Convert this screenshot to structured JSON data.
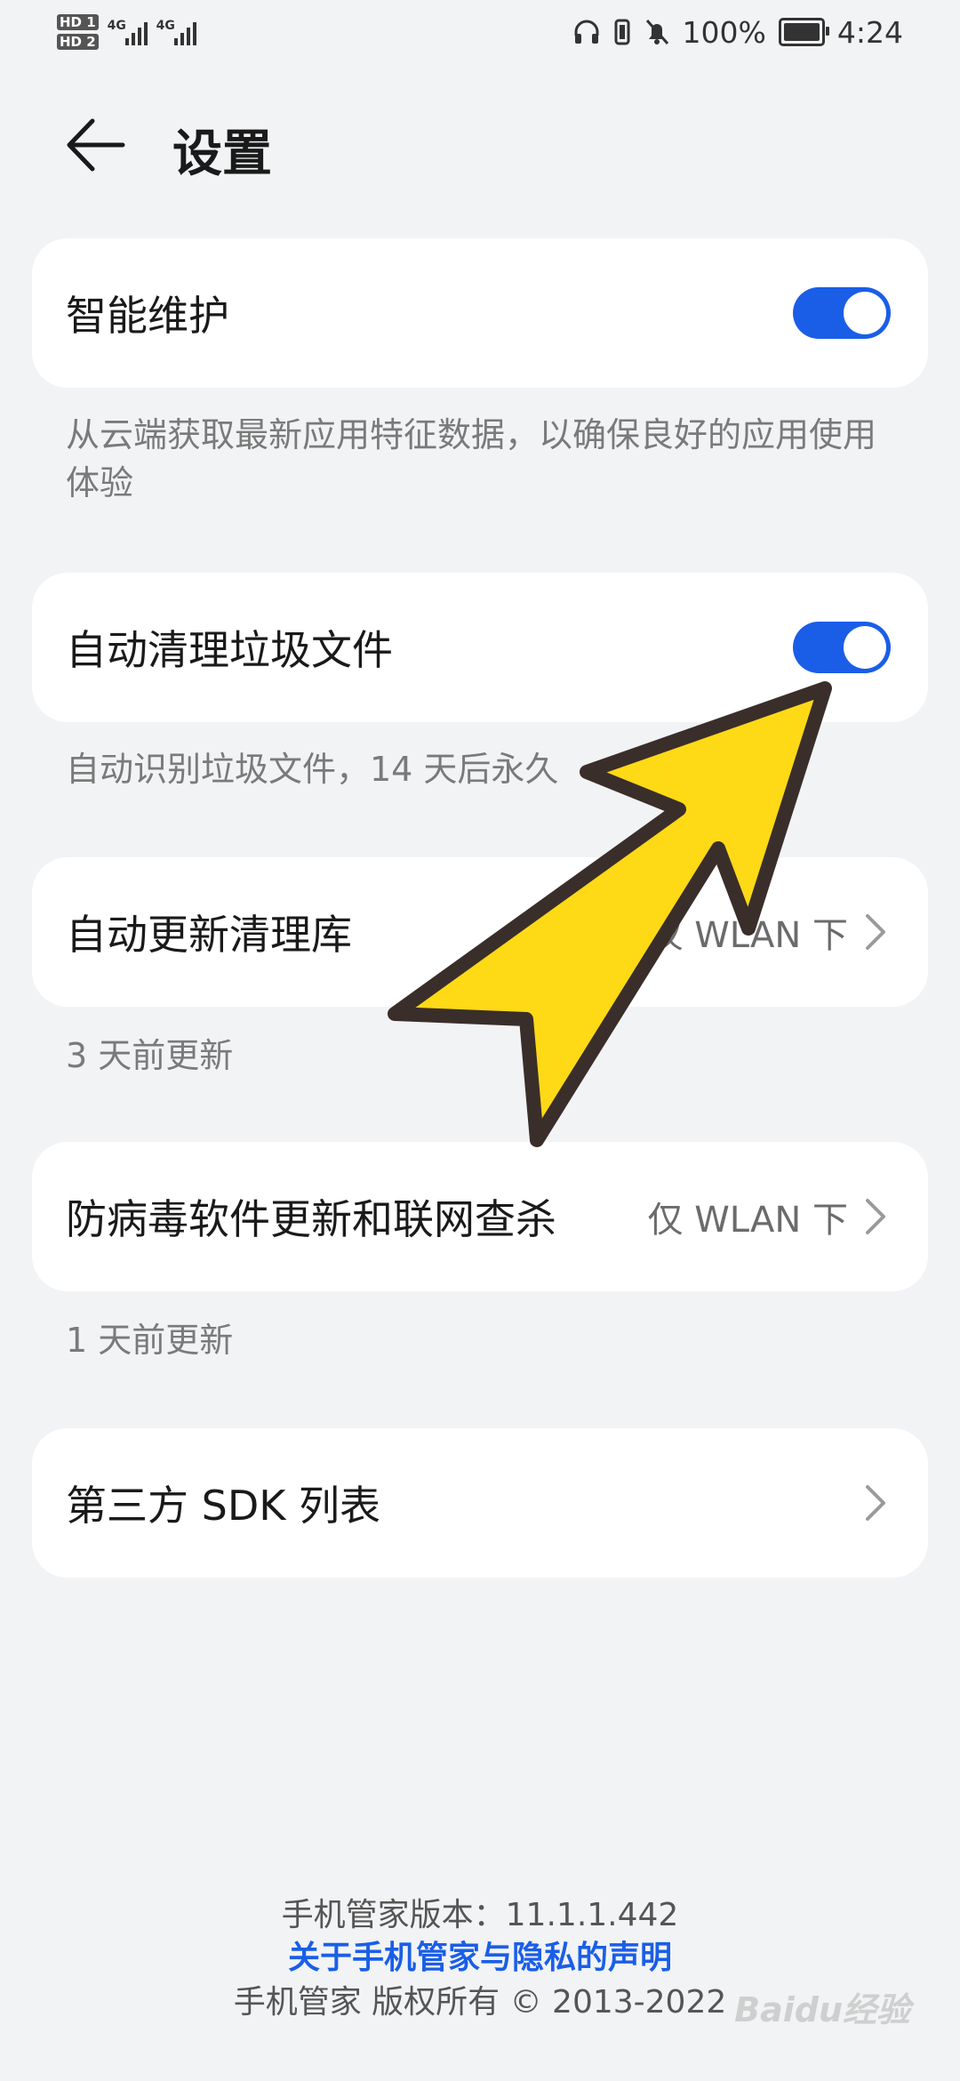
{
  "status_bar": {
    "sim1": "HD 1",
    "sim2": "HD 2",
    "net1": "4G",
    "net2": "4G",
    "battery_pct": "100%",
    "time": "4:24"
  },
  "header": {
    "title": "设置"
  },
  "items": [
    {
      "label": "智能维护",
      "toggle_on": true,
      "description": "从云端获取最新应用特征数据，以确保良好的应用使用体验"
    },
    {
      "label": "自动清理垃圾文件",
      "toggle_on": true,
      "description": "自动识别垃圾文件，14 天后永久"
    },
    {
      "label": "自动更新清理库",
      "value": "仅 WLAN 下",
      "description": "3 天前更新"
    },
    {
      "label": "防病毒软件更新和联网查杀",
      "value": "仅 WLAN 下",
      "description": "1 天前更新"
    },
    {
      "label": "第三方 SDK 列表"
    }
  ],
  "footer": {
    "version": "手机管家版本：11.1.1.442",
    "privacy_link": "关于手机管家与隐私的声明",
    "copyright": "手机管家 版权所有 © 2013-2022"
  },
  "watermark": "Baidu经验",
  "colors": {
    "accent": "#1a5ee8",
    "background": "#f1f3f5",
    "arrow_fill": "#fdd916",
    "arrow_stroke": "#3a2e2a"
  }
}
